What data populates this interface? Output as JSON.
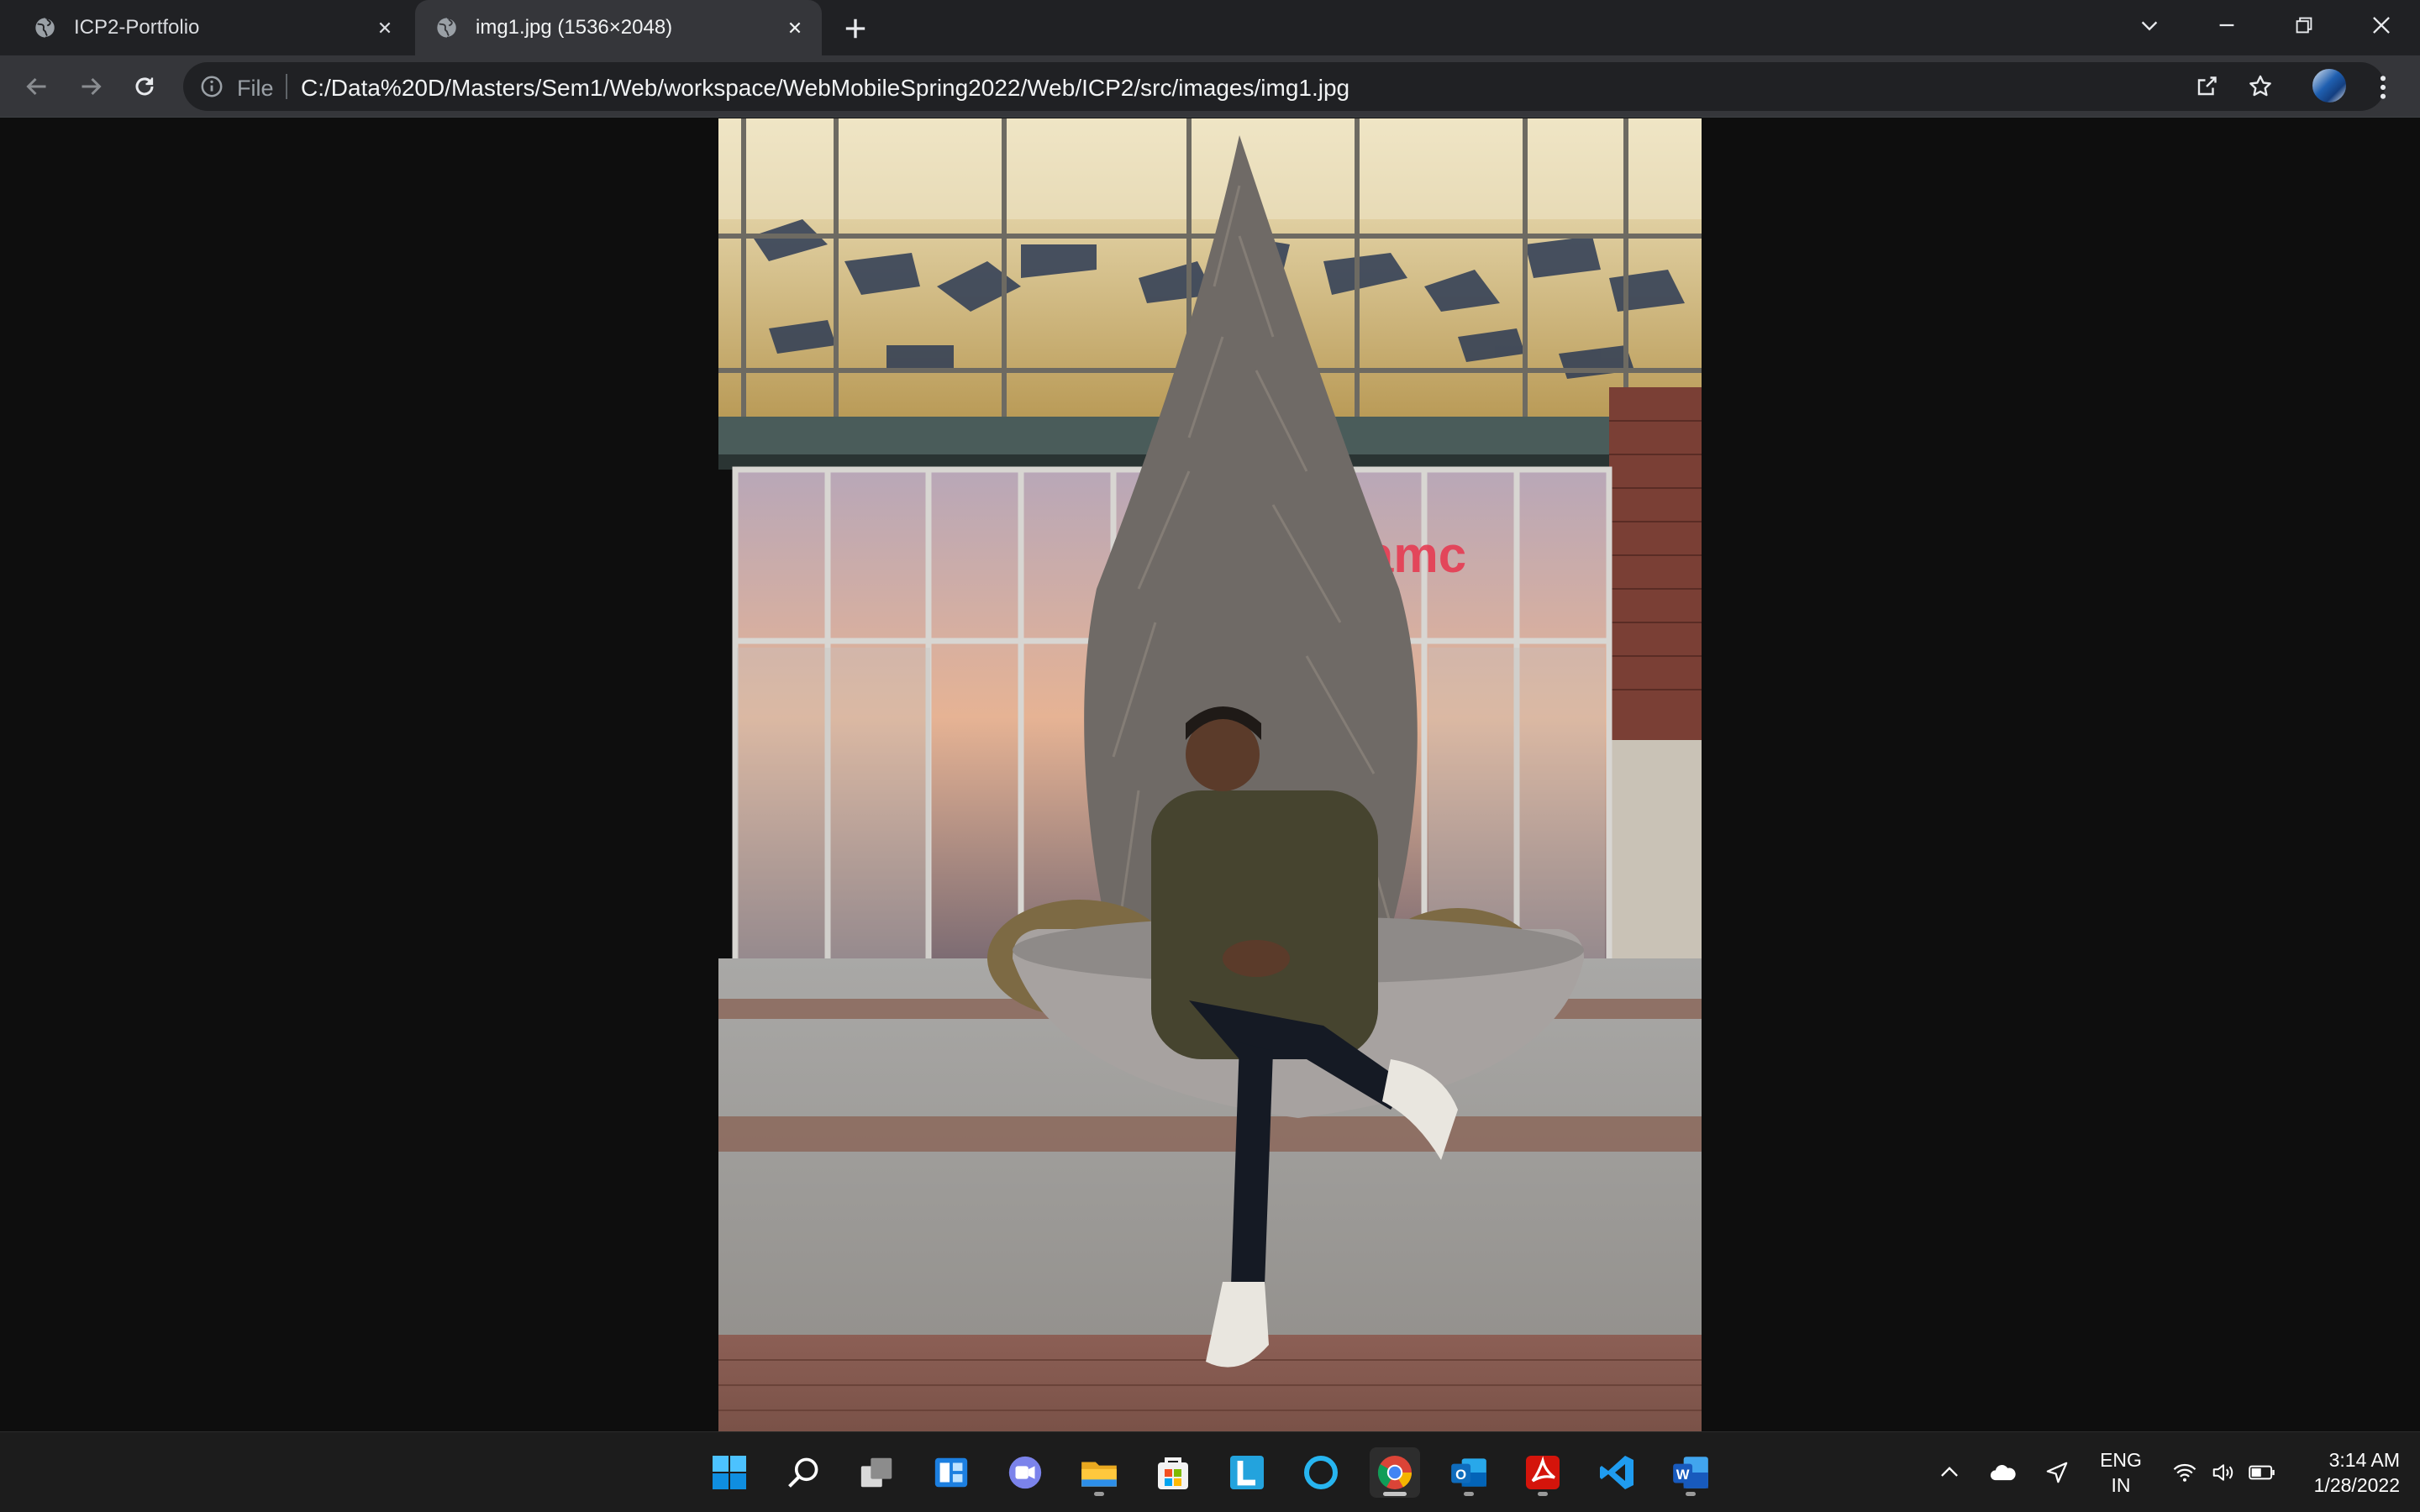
{
  "browser": {
    "tabs": [
      {
        "title": "ICP2-Portfolio",
        "active": false
      },
      {
        "title": "img1.jpg (1536×2048)",
        "active": true
      }
    ],
    "address_bar": {
      "scheme_label": "File",
      "url": "C:/Data%20D/Masters/Sem1/Web/workspace/WebMobileSpring2022/Web/ICP2/src/images/img1.jpg"
    },
    "icons": [
      "globe-icon",
      "close-icon",
      "plus-icon",
      "chevron-down-icon",
      "minimize-icon",
      "restore-icon",
      "close-window-icon",
      "back-icon",
      "forward-icon",
      "reload-icon",
      "info-icon",
      "share-icon",
      "star-icon",
      "profile-avatar",
      "more-vert-icon"
    ]
  },
  "content": {
    "image_description": "Photo: man in olive jacket and dark jeans seated on the edge of a round concrete planter with a tall evergreen shrub, in front of a glass building entrance at dusk; brick-striped pavement in foreground"
  },
  "taskbar": {
    "apps": [
      {
        "name": "start",
        "pip": false
      },
      {
        "name": "search",
        "pip": false
      },
      {
        "name": "task-view",
        "pip": false
      },
      {
        "name": "widgets",
        "pip": false
      },
      {
        "name": "chat",
        "pip": false
      },
      {
        "name": "file-explorer",
        "pip": true
      },
      {
        "name": "store",
        "pip": false
      },
      {
        "name": "l-app",
        "label": "L",
        "pip": false
      },
      {
        "name": "cortana",
        "pip": false
      },
      {
        "name": "chrome",
        "pip": true,
        "active": true
      },
      {
        "name": "outlook",
        "label": "O",
        "pip": true
      },
      {
        "name": "acrobat",
        "pip": true
      },
      {
        "name": "vscode",
        "pip": false
      },
      {
        "name": "word",
        "label": "W",
        "pip": true
      }
    ],
    "tray": {
      "language": "ENG",
      "region": "IN",
      "time": "3:14 AM",
      "date": "1/28/2022"
    }
  },
  "colors": {
    "tabstrip": "#202124",
    "toolbar": "#35363a",
    "page_background": "#0e0e0e",
    "taskbar": "#1c1c1c"
  }
}
